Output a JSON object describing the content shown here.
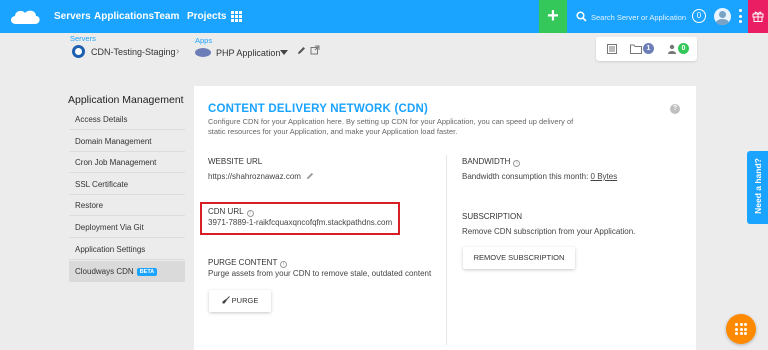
{
  "topbar": {
    "nav": [
      "Servers",
      "Applications",
      "Team",
      "Projects"
    ],
    "search_placeholder": "Search Server or Application",
    "notification_count": "0",
    "colors": {
      "bar": "#1aa3ff",
      "add": "#34c759",
      "gift": "#e91e63"
    }
  },
  "breadcrumb": {
    "servers_label": "Servers",
    "server_name": "CDN-Testing-Staging",
    "apps_label": "Apps",
    "app_name": "PHP Application"
  },
  "toolbar": {
    "files_count": "1",
    "users_count": "0"
  },
  "sidebar": {
    "title": "Application Management",
    "items": [
      {
        "label": "Access Details"
      },
      {
        "label": "Domain Management"
      },
      {
        "label": "Cron Job Management"
      },
      {
        "label": "SSL Certificate"
      },
      {
        "label": "Restore"
      },
      {
        "label": "Deployment Via Git"
      },
      {
        "label": "Application Settings"
      },
      {
        "label": "Cloudways CDN",
        "badge": "BETA",
        "active": true
      }
    ]
  },
  "cdn": {
    "title": "CONTENT DELIVERY NETWORK (CDN)",
    "description": "Configure CDN for your Application here. By setting up CDN for your Application, you can speed up delivery of static resources for your Application, and make your Application load faster.",
    "website_url_label": "WEBSITE URL",
    "website_url": "https://shahroznawaz.com",
    "cdn_url_label": "CDN URL",
    "cdn_url": "3971-7889-1-raikfcquaxqncofqfm.stackpathdns.com",
    "purge_label": "PURGE CONTENT",
    "purge_desc": "Purge assets from your CDN to remove stale, outdated content",
    "purge_button": "PURGE",
    "bandwidth_label": "BANDWIDTH",
    "bandwidth_text": "Bandwidth consumption this month:",
    "bandwidth_value": "0 Bytes",
    "subscription_label": "SUBSCRIPTION",
    "subscription_desc": "Remove CDN subscription from your Application.",
    "remove_button": "REMOVE SUBSCRIPTION"
  },
  "help_tab": "Need a hand?",
  "fab_icon": "apps-grid-icon"
}
